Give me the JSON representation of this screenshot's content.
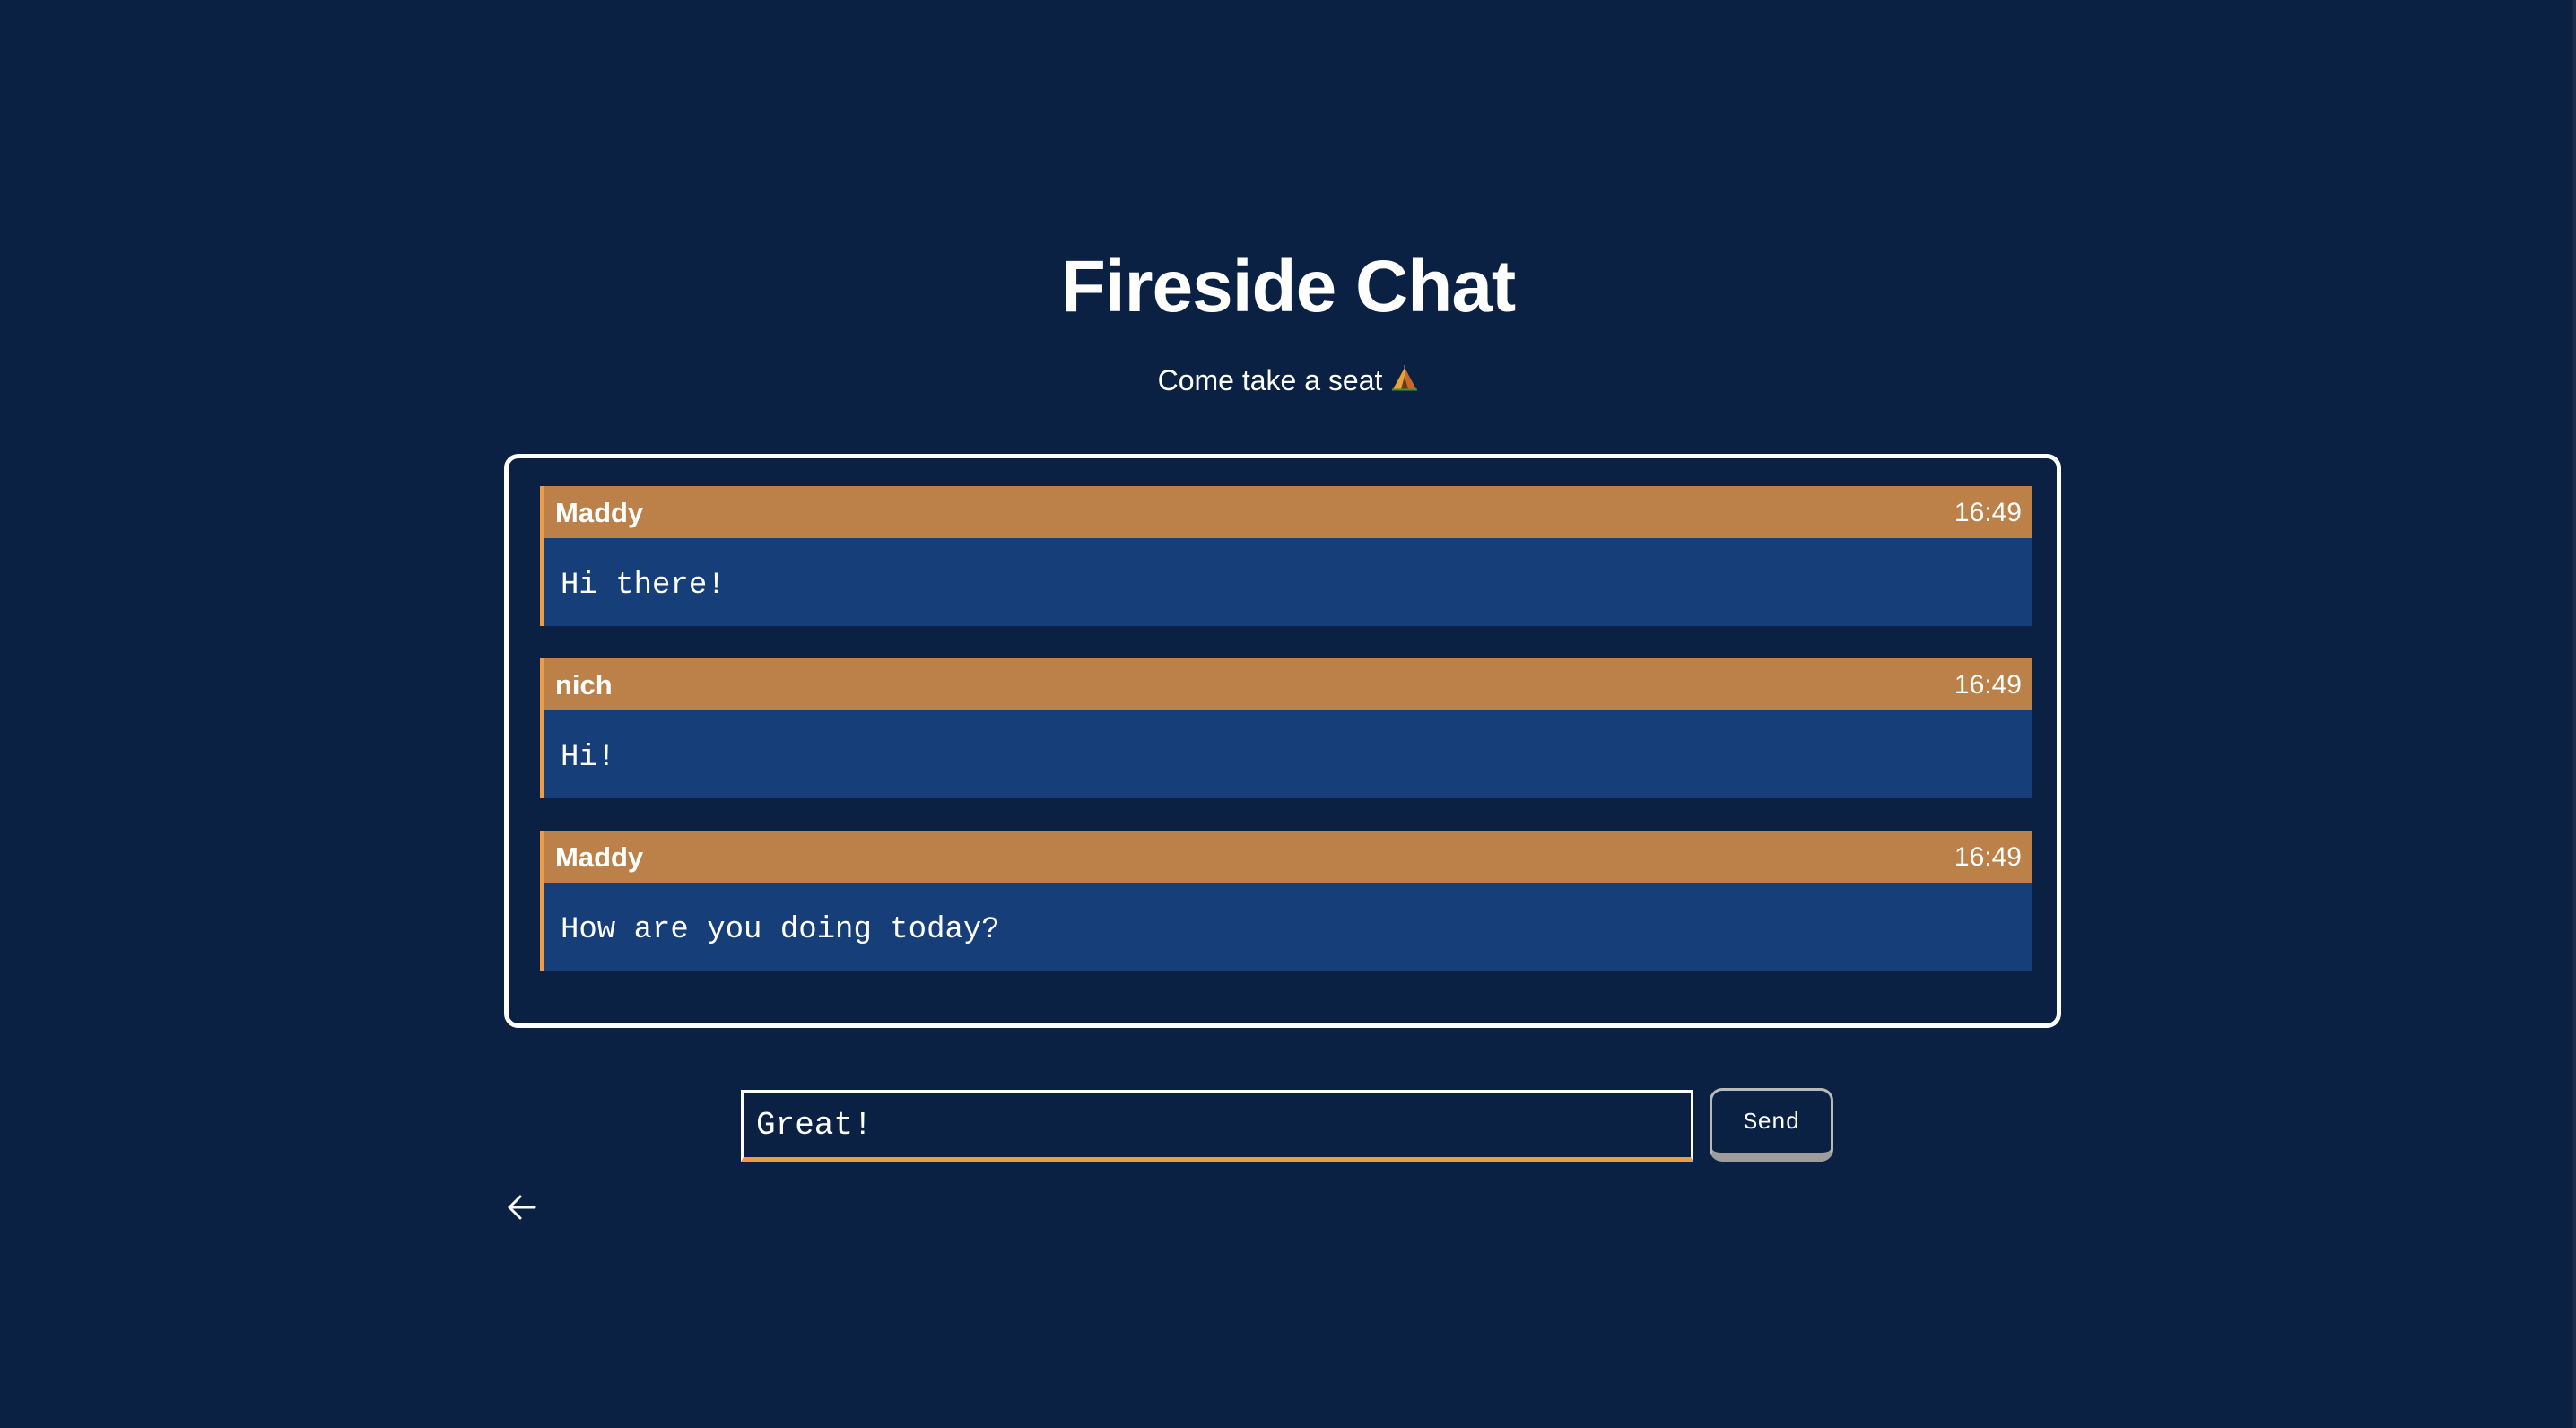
{
  "header": {
    "title": "Fireside Chat",
    "subtitle": "Come take a seat",
    "subtitle_icon": "camping-tent-icon"
  },
  "messages": [
    {
      "author": "Maddy",
      "time": "16:49",
      "text": "Hi there!"
    },
    {
      "author": "nich",
      "time": "16:49",
      "text": "Hi!"
    },
    {
      "author": "Maddy",
      "time": "16:49",
      "text": "How are you doing today?"
    }
  ],
  "composer": {
    "value": "Great!",
    "send_label": "Send"
  },
  "navigation": {
    "back_icon": "arrow-left-icon"
  },
  "colors": {
    "background": "#0a2144",
    "message_header": "#bb8148",
    "message_body": "#163e78",
    "accent": "#ee9c46",
    "text": "#ffffff"
  }
}
